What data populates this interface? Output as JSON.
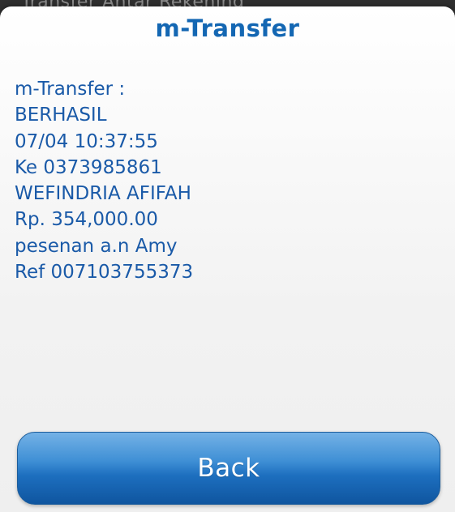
{
  "background": {
    "partial_text": "Transfer Antar Rekening"
  },
  "dialog": {
    "title": "m-Transfer",
    "lines": [
      "m-Transfer :",
      "BERHASIL",
      "07/04 10:37:55",
      "Ke 0373985861",
      "WEFINDRIA AFIFAH",
      "Rp. 354,000.00",
      "pesenan a.n Amy",
      "Ref 007103755373"
    ],
    "back_label": "Back"
  },
  "colors": {
    "title": "#1467b3",
    "text": "#1a5aa8",
    "button_top": "#74b2e6",
    "button_bottom": "#0f559f"
  }
}
